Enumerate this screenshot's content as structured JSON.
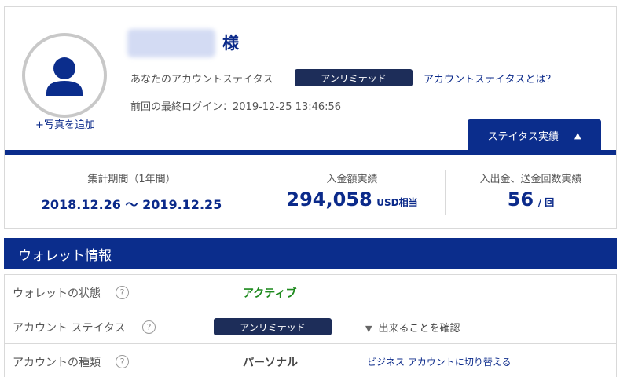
{
  "profile": {
    "honorific": "様",
    "add_photo": "+写真を追加",
    "status_label": "あなたのアカウントステイタス",
    "status_badge": "アンリミテッド",
    "status_link": "アカウントステイタスとは？",
    "last_login": "前回の最終ログイン：2019-12-25 13:46:56",
    "status_record_tab": "ステイタス実績",
    "status_record_chevron": "chevron-up-icon"
  },
  "stats": {
    "period_label": "集計期間（1年間）",
    "period_value": "2018.12.26 〜 2019.12.25",
    "deposit_label": "入金額実績",
    "deposit_value": "294,058",
    "deposit_unit": "USD相当",
    "count_label": "入出金、送金回数実績",
    "count_value": "56",
    "count_unit": "/ 回"
  },
  "wallet": {
    "title": "ウォレット情報",
    "help_glyph": "?",
    "rows": [
      {
        "label": "ウォレットの状態",
        "value": "アクティブ"
      },
      {
        "label": "アカウント ステイタス",
        "badge": "アンリミテッド",
        "action": "出来ることを確認",
        "action_icon": "chevron-down-icon"
      },
      {
        "label": "アカウントの種類",
        "value": "パーソナル",
        "link": "ビジネス アカウントに切り替える"
      }
    ]
  },
  "colors": {
    "brand_navy": "#0b2d8c",
    "badge_navy": "#1d2d59",
    "active_green": "#1e8a1e",
    "text_blue": "#0b2a8a"
  }
}
